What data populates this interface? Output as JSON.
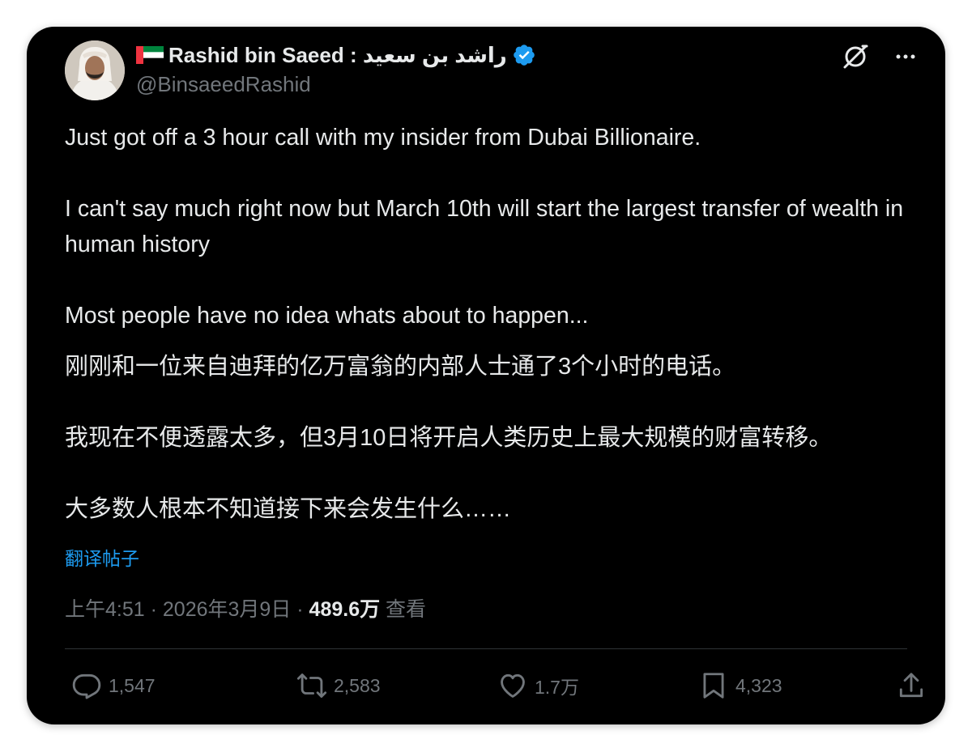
{
  "author": {
    "display_name": "Rashid bin Saeed : راشد بن سعيد",
    "handle": "@BinsaeedRashid",
    "flag_icon": "uae-flag-icon",
    "verified_icon": "verified-badge-icon",
    "verified_color": "#1d9bf0"
  },
  "header_icons": {
    "grok": "grok-icon",
    "more": "more-icon"
  },
  "post": {
    "english": {
      "line1": "Just got off a 3 hour call with my insider from Dubai Billionaire.",
      "line2": "I can't say much right now but March 10th will start the largest transfer of wealth in human history",
      "line3": "Most people have no idea whats about to happen..."
    },
    "chinese": {
      "line1": "刚刚和一位来自迪拜的亿万富翁的内部人士通了3个小时的电话。",
      "line2": "我现在不便透露太多，但3月10日将开启人类历史上最大规模的财富转移。",
      "line3": "大多数人根本不知道接下来会发生什么……"
    },
    "translate_label": "翻译帖子",
    "translate_color": "#1d9bf0"
  },
  "meta": {
    "time": "上午4:51",
    "sep1": " · ",
    "date": "2026年3月9日",
    "sep2": " · ",
    "views_count": "489.6万",
    "views_label": " 查看"
  },
  "actions": {
    "reply": {
      "icon": "reply-icon",
      "count": "1,547"
    },
    "repost": {
      "icon": "repost-icon",
      "count": "2,583"
    },
    "like": {
      "icon": "heart-icon",
      "count": "1.7万"
    },
    "bookmark": {
      "icon": "bookmark-icon",
      "count": "4,323"
    },
    "share": {
      "icon": "share-icon"
    }
  },
  "colors": {
    "background": "#000000",
    "text": "#e7e9ea",
    "muted": "#71767b",
    "divider": "#2f3336"
  }
}
